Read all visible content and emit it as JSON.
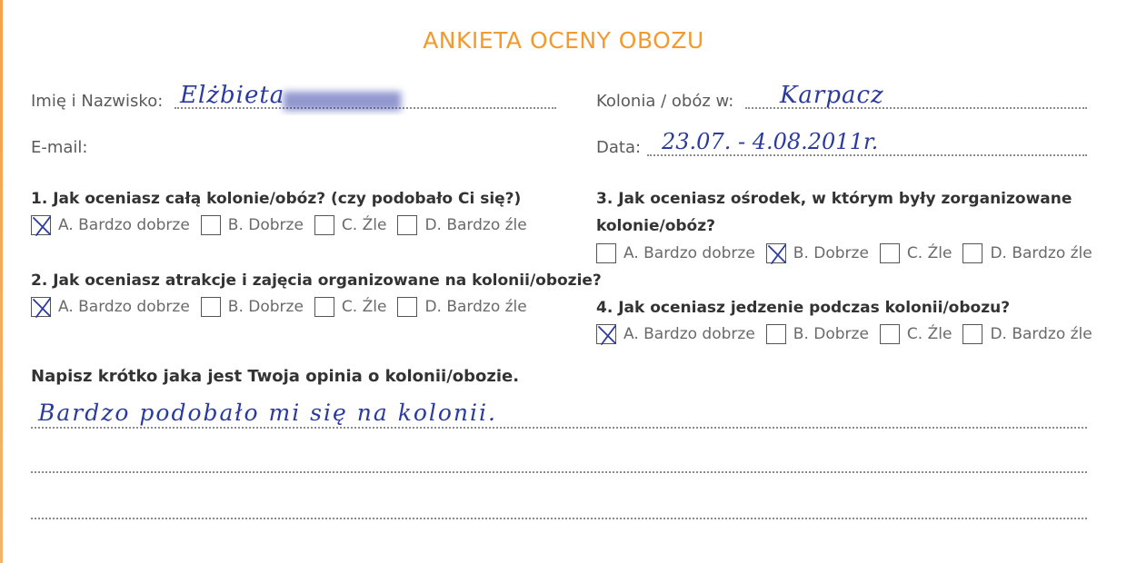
{
  "title": "ANKIETA OCENY OBOZU",
  "fields": {
    "name_label": "Imię i Nazwisko:",
    "name_value": "Elżbieta",
    "email_label": "E-mail:",
    "camp_label": "Kolonia / obóz w:",
    "camp_value": "Karpacz",
    "date_label": "Data:",
    "date_value": "23.07. - 4.08.2011r."
  },
  "questions": [
    {
      "text": "1. Jak oceniasz całą kolonie/obóz? (czy podobało Ci się?)",
      "options": [
        "A. Bardzo dobrze",
        "B. Dobrze",
        "C. Źle",
        "D. Bardzo źle"
      ],
      "checked": 0
    },
    {
      "text": "2.  Jak oceniasz atrakcje i zajęcia organizowane na kolonii/obozie?",
      "options": [
        "A. Bardzo dobrze",
        "B. Dobrze",
        "C. Źle",
        "D. Bardzo źle"
      ],
      "checked": 0
    },
    {
      "text_line1": "3. Jak oceniasz ośrodek, w którym były zorganizowane",
      "text_line2": "kolonie/obóz?",
      "options": [
        "A. Bardzo dobrze",
        "B. Dobrze",
        "C. Źle",
        "D. Bardzo źle"
      ],
      "checked": 1
    },
    {
      "text": "4.  Jak oceniasz jedzenie podczas kolonii/obozu?",
      "options": [
        "A. Bardzo dobrze",
        "B. Dobrze",
        "C. Źle",
        "D. Bardzo źle"
      ],
      "checked": 0
    }
  ],
  "opinion": {
    "prompt": "Napisz krótko jaka jest Twoja opinia o kolonii/obozie.",
    "answer": "Bardzo podobało mi się na kolonii."
  },
  "colors": {
    "accent": "#f39a2e",
    "ink": "#2b3a9e"
  }
}
